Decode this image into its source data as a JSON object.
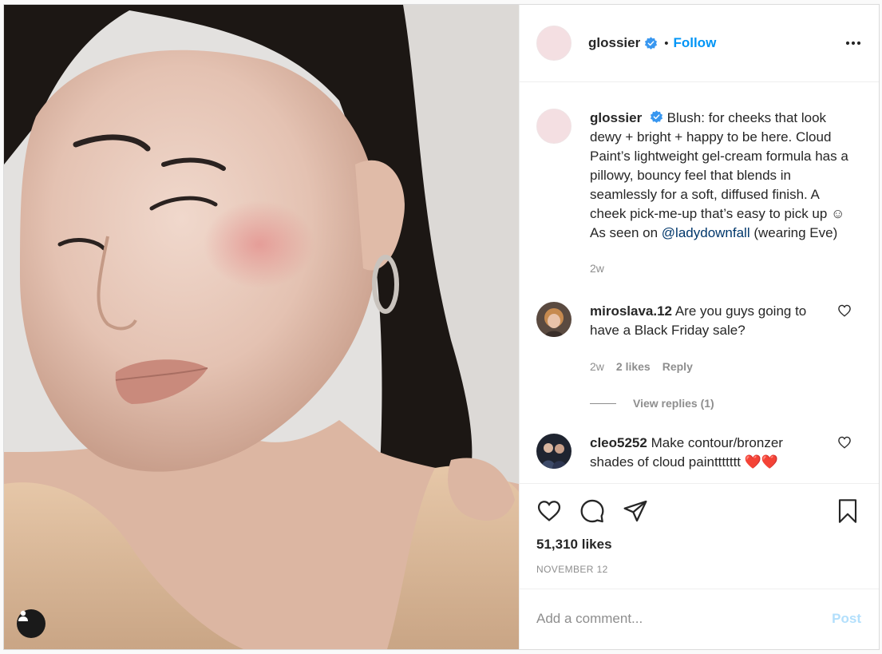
{
  "post": {
    "username": "glossier",
    "follow_label": "Follow",
    "dot": "•"
  },
  "caption": {
    "username": "glossier",
    "text_before_mention": "Blush: for cheeks that look dewy + bright + happy to be here. Cloud Paint’s lightweight gel-cream formula has a pillowy, bouncy feel that blends in seamlessly for a soft, diffused finish. A cheek pick-me-up that’s easy to pick up ☺ As seen on",
    "mention": "@ladydownfall",
    "text_after_mention": "(wearing Eve)",
    "age": "2w"
  },
  "comments": [
    {
      "username": "miroslava.12",
      "text": "Are you guys going to have a Black Friday sale?",
      "age": "2w",
      "likes": "2 likes",
      "reply_label": "Reply",
      "view_replies": "View replies (1)"
    },
    {
      "username": "cleo5252",
      "text": "Make contour/bronzer shades of cloud painttttttt",
      "emoji": "❤️❤️"
    }
  ],
  "engagement": {
    "likes": "51,310 likes",
    "date": "NOVEMBER 12"
  },
  "composer": {
    "placeholder": "Add a comment...",
    "post_label": "Post"
  },
  "colors": {
    "accent": "#0095f6",
    "post_disabled": "#b2dffc",
    "mention": "#00376b",
    "avatar_pink": "#f4dfe2"
  },
  "icons": [
    "user-tag-icon",
    "verified-badge-icon",
    "more-options-icon",
    "heart-icon",
    "comment-icon",
    "share-icon",
    "bookmark-icon"
  ]
}
